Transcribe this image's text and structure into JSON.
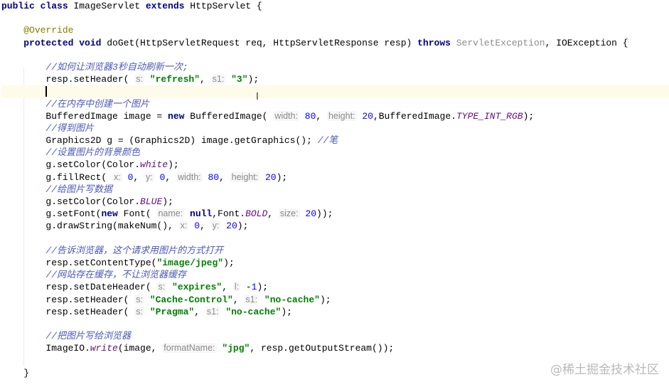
{
  "editor": {
    "current_line": 7,
    "lines": [
      [
        [
          "kw",
          "public class "
        ],
        [
          "t",
          "ImageServlet "
        ],
        [
          "kw",
          "extends "
        ],
        [
          "t",
          "HttpServlet {"
        ]
      ],
      [],
      [
        [
          "t",
          "    "
        ],
        [
          "an",
          "@Override"
        ]
      ],
      [
        [
          "t",
          "    "
        ],
        [
          "kw",
          "protected void "
        ],
        [
          "t",
          "doGet(HttpServletRequest req, HttpServletResponse resp) "
        ],
        [
          "kw",
          "throws "
        ],
        [
          "unused",
          "ServletException"
        ],
        [
          "t",
          ", IOException {"
        ]
      ],
      [],
      [
        [
          "t",
          "        "
        ],
        [
          "cm",
          "//如何让浏览器3秒自动刷新一次;"
        ]
      ],
      [
        [
          "t",
          "        resp.setHeader( "
        ],
        [
          "hint",
          "s:"
        ],
        [
          "t",
          " "
        ],
        [
          "str",
          "\"refresh\""
        ],
        [
          "t",
          ", "
        ],
        [
          "hint",
          "s1:"
        ],
        [
          "t",
          " "
        ],
        [
          "str",
          "\"3\""
        ],
        [
          "t",
          ");"
        ]
      ],
      [
        [
          "t",
          "        "
        ],
        [
          "caret",
          ""
        ]
      ],
      [
        [
          "t",
          "        "
        ],
        [
          "cm",
          "//在内存中创建一个图片"
        ]
      ],
      [
        [
          "t",
          "        BufferedImage image = "
        ],
        [
          "kw",
          "new "
        ],
        [
          "t",
          "BufferedImage( "
        ],
        [
          "hint",
          "width:"
        ],
        [
          "t",
          " "
        ],
        [
          "num",
          "80"
        ],
        [
          "t",
          ", "
        ],
        [
          "hint",
          "height:"
        ],
        [
          "t",
          " "
        ],
        [
          "num",
          "20"
        ],
        [
          "t",
          ",BufferedImage."
        ],
        [
          "st",
          "TYPE_INT_RGB"
        ],
        [
          "t",
          ");"
        ]
      ],
      [
        [
          "t",
          "        "
        ],
        [
          "cm",
          "//得到图片"
        ]
      ],
      [
        [
          "t",
          "        Graphics2D g = (Graphics2D) image.getGraphics(); "
        ],
        [
          "cm",
          "//笔"
        ]
      ],
      [
        [
          "t",
          "        "
        ],
        [
          "cm",
          "//设置图片的背景颜色"
        ]
      ],
      [
        [
          "t",
          "        g.setColor(Color."
        ],
        [
          "st",
          "white"
        ],
        [
          "t",
          ");"
        ]
      ],
      [
        [
          "t",
          "        g.fillRect( "
        ],
        [
          "hint",
          "x:"
        ],
        [
          "t",
          " "
        ],
        [
          "num",
          "0"
        ],
        [
          "t",
          ", "
        ],
        [
          "hint",
          "y:"
        ],
        [
          "t",
          " "
        ],
        [
          "num",
          "0"
        ],
        [
          "t",
          ", "
        ],
        [
          "hint",
          "width:"
        ],
        [
          "t",
          " "
        ],
        [
          "num",
          "80"
        ],
        [
          "t",
          ", "
        ],
        [
          "hint",
          "height:"
        ],
        [
          "t",
          " "
        ],
        [
          "num",
          "20"
        ],
        [
          "t",
          ");"
        ]
      ],
      [
        [
          "t",
          "        "
        ],
        [
          "cm",
          "//给图片写数据"
        ]
      ],
      [
        [
          "t",
          "        g.setColor(Color."
        ],
        [
          "st",
          "BLUE"
        ],
        [
          "t",
          ");"
        ]
      ],
      [
        [
          "t",
          "        g.setFont("
        ],
        [
          "kw",
          "new "
        ],
        [
          "t",
          "Font( "
        ],
        [
          "hint",
          "name:"
        ],
        [
          "t",
          " "
        ],
        [
          "kw",
          "null"
        ],
        [
          "t",
          ",Font."
        ],
        [
          "st",
          "BOLD"
        ],
        [
          "t",
          ", "
        ],
        [
          "hint",
          "size:"
        ],
        [
          "t",
          " "
        ],
        [
          "num",
          "20"
        ],
        [
          "t",
          "));"
        ]
      ],
      [
        [
          "t",
          "        g.drawString(makeNum(), "
        ],
        [
          "hint",
          "x:"
        ],
        [
          "t",
          " "
        ],
        [
          "num",
          "0"
        ],
        [
          "t",
          ", "
        ],
        [
          "hint",
          "y:"
        ],
        [
          "t",
          " "
        ],
        [
          "num",
          "20"
        ],
        [
          "t",
          ");"
        ]
      ],
      [],
      [
        [
          "t",
          "        "
        ],
        [
          "cm",
          "//告诉浏览器，这个请求用图片的方式打开"
        ]
      ],
      [
        [
          "t",
          "        resp.setContentType("
        ],
        [
          "str",
          "\"image/jpeg\""
        ],
        [
          "t",
          ");"
        ]
      ],
      [
        [
          "t",
          "        "
        ],
        [
          "cm",
          "//网站存在缓存，不让浏览器缓存"
        ]
      ],
      [
        [
          "t",
          "        resp.setDateHeader( "
        ],
        [
          "hint",
          "s:"
        ],
        [
          "t",
          " "
        ],
        [
          "str",
          "\"expires\""
        ],
        [
          "t",
          ", "
        ],
        [
          "hint",
          "l:"
        ],
        [
          "t",
          " -"
        ],
        [
          "num",
          "1"
        ],
        [
          "t",
          ");"
        ]
      ],
      [
        [
          "t",
          "        resp.setHeader( "
        ],
        [
          "hint",
          "s:"
        ],
        [
          "t",
          " "
        ],
        [
          "str",
          "\"Cache-Control\""
        ],
        [
          "t",
          ", "
        ],
        [
          "hint",
          "s1:"
        ],
        [
          "t",
          " "
        ],
        [
          "str",
          "\"no-cache\""
        ],
        [
          "t",
          ");"
        ]
      ],
      [
        [
          "t",
          "        resp.setHeader( "
        ],
        [
          "hint",
          "s:"
        ],
        [
          "t",
          " "
        ],
        [
          "str",
          "\"Pragma\""
        ],
        [
          "t",
          ", "
        ],
        [
          "hint",
          "s1:"
        ],
        [
          "t",
          " "
        ],
        [
          "str",
          "\"no-cache\""
        ],
        [
          "t",
          ");"
        ]
      ],
      [],
      [
        [
          "t",
          "        "
        ],
        [
          "cm",
          "//把图片写给浏览器"
        ]
      ],
      [
        [
          "t",
          "        ImageIO."
        ],
        [
          "st",
          "write"
        ],
        [
          "t",
          "(image, "
        ],
        [
          "hint",
          "formatName:"
        ],
        [
          "t",
          " "
        ],
        [
          "str",
          "\"jpg\""
        ],
        [
          "t",
          ", resp.getOutputStream());"
        ]
      ],
      [],
      [
        [
          "t",
          "    }"
        ]
      ]
    ]
  },
  "watermark": "@稀土掘金技术社区"
}
